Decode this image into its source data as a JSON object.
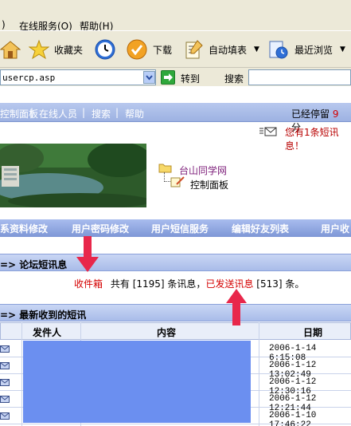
{
  "browser": {
    "menu": {
      "online_service": "在线服务(O)",
      "help": "帮助(H)"
    },
    "toolbar": {
      "favorites": "收藏夹",
      "download": "下载",
      "autofill": "自动填表",
      "recent": "最近浏览"
    },
    "address": {
      "value": "usercp.asp",
      "go_label": "转到",
      "search_label": "搜索"
    }
  },
  "nav": {
    "links": [
      "控制面板",
      "在线人员",
      "搜索",
      "帮助"
    ],
    "stay_text": "已经停留",
    "stay_num": "9",
    "stay_unit": "分",
    "notice": "您有1条短讯息！"
  },
  "tree": {
    "root": "台山同学网",
    "child": "控制面板"
  },
  "functions": [
    "联系资料修改",
    "用户密码修改",
    "用户短信服务",
    "编辑好友列表",
    "用户收"
  ],
  "forum_section": {
    "title": "=> 论坛短讯息",
    "inbox_link": "收件箱",
    "summary_prefix": "共有",
    "inbox_count": "[1195]",
    "summary_mid": "条讯息，",
    "sent_link": "已发送讯息",
    "sent_count": "[513]",
    "summary_suffix": "条。"
  },
  "latest_section": {
    "title": "=> 最新收到的短讯",
    "columns": [
      "发件人",
      "内容",
      "日期"
    ],
    "dates": [
      "2006-1-14 6:15:08",
      "2006-1-12 13:02:49",
      "2006-1-12 12:30:16",
      "2006-1-12 12:21:44",
      "2006-1-10 17:46:22"
    ]
  }
}
